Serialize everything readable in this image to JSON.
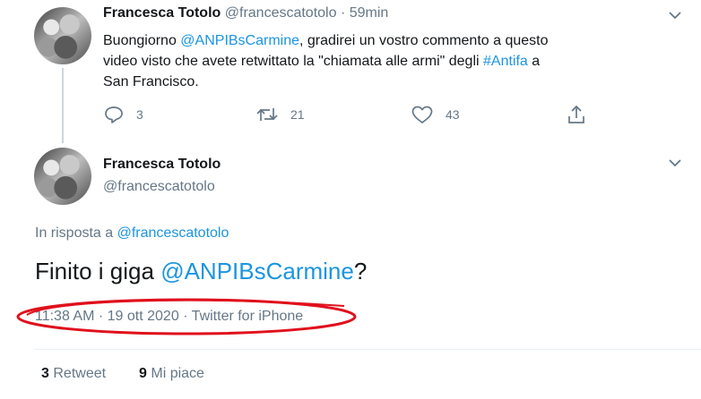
{
  "tweet1": {
    "name": "Francesca Totolo",
    "handle": "@francescatotolo",
    "dot": "·",
    "time": "59min",
    "text_1": "Buongiorno ",
    "mention": "@ANPIBsCarmine",
    "text_2": ", gradirei un vostro commento a questo video visto che avete retwittato la \"chiamata alle armi\" degli ",
    "hashtag": "#Antifa",
    "text_3": " a San Francisco.",
    "replies": "3",
    "retweets": "21",
    "likes": "43"
  },
  "tweet2": {
    "name": "Francesca Totolo",
    "handle": "@francescatotolo",
    "reply_prefix": "In risposta a ",
    "reply_handle": "@francescatotolo",
    "text_1": "Finito i giga ",
    "mention": "@ANPIBsCarmine",
    "text_2": "?",
    "meta_time": "11:38 AM",
    "meta_sep1": "·",
    "meta_date": "19 ott 2020",
    "meta_sep2": "·",
    "meta_source": "Twitter for iPhone",
    "retweet_count": "3",
    "retweet_label": "Retweet",
    "like_count": "9",
    "like_label": "Mi piace"
  },
  "colors": {
    "link": "#1b95e0",
    "secondary": "#657786",
    "annotation": "#e0101c"
  },
  "icons": [
    "reply-icon",
    "retweet-icon",
    "like-icon",
    "share-icon",
    "chevron-down-icon"
  ]
}
